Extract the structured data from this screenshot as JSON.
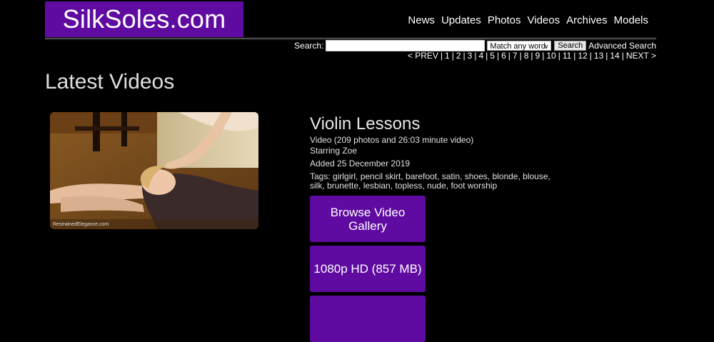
{
  "site": {
    "logo": "SilkSoles.com"
  },
  "nav": {
    "items": [
      "News",
      "Updates",
      "Photos",
      "Videos",
      "Archives",
      "Models"
    ]
  },
  "search": {
    "label": "Search:",
    "value": "",
    "match_select": "Match any word",
    "button": "Search",
    "advanced": "Advanced Search"
  },
  "pager": {
    "prev": "< PREV",
    "pages": [
      "1",
      "2",
      "3",
      "4",
      "5",
      "6",
      "7",
      "8",
      "9",
      "10",
      "11",
      "12",
      "13",
      "14"
    ],
    "next": "NEXT >"
  },
  "page": {
    "heading": "Latest Videos"
  },
  "video": {
    "title": "Violin Lessons",
    "type": "Video (209 photos and 26:03 minute video)",
    "starring": "Starring Zoe",
    "added": "Added 25 December 2019",
    "tags": "Tags: girlgirl, pencil skirt, barefoot, satin, shoes, blonde, blouse, silk, brunette, lesbian, topless, nude, foot worship",
    "watermark": "RestrainedElegance.com",
    "buttons": [
      "Browse Video Gallery",
      "1080p HD (857 MB)"
    ]
  },
  "colors": {
    "brand_purple": "#5f0aa0",
    "background": "#000000"
  }
}
